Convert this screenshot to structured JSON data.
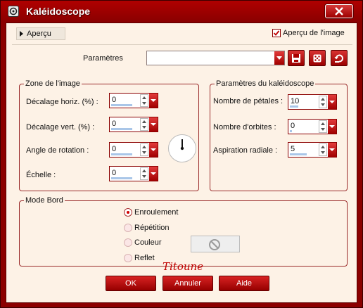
{
  "window": {
    "title": "Kaléidoscope",
    "accent": "#8b0000",
    "background": "#fdf2e6"
  },
  "preview": {
    "toggle_label": "Aperçu",
    "checkbox_label": "Aperçu de l'image",
    "checked": true
  },
  "params": {
    "label": "Paramètres",
    "combo_value": ""
  },
  "icons": {
    "save": "save-icon",
    "random": "dice-icon",
    "reset": "reset-icon",
    "close": "close-icon",
    "no_color": "no-symbol-icon"
  },
  "image_zone": {
    "title": "Zone de l'image",
    "fields": [
      {
        "label": "Décalage horiz. (%) :",
        "value": "0"
      },
      {
        "label": "Décalage vert. (%) :",
        "value": "0"
      },
      {
        "label": "Angle de rotation :",
        "value": "0"
      },
      {
        "label": "Échelle :",
        "value": "0"
      }
    ]
  },
  "kaleido": {
    "title": "Paramètres du kaléidoscope",
    "fields": [
      {
        "label": "Nombre de pétales :",
        "value": "10"
      },
      {
        "label": "Nombre d'orbites :",
        "value": "0"
      },
      {
        "label": "Aspiration radiale :",
        "value": "5"
      }
    ]
  },
  "border_mode": {
    "title": "Mode Bord",
    "options": [
      {
        "label": "Enroulement",
        "selected": true
      },
      {
        "label": "Répétition",
        "selected": false
      },
      {
        "label": "Couleur",
        "selected": false
      },
      {
        "label": "Reflet",
        "selected": false
      }
    ]
  },
  "signature": "Titoune",
  "buttons": {
    "ok": "OK",
    "cancel": "Annuler",
    "help": "Aide"
  }
}
